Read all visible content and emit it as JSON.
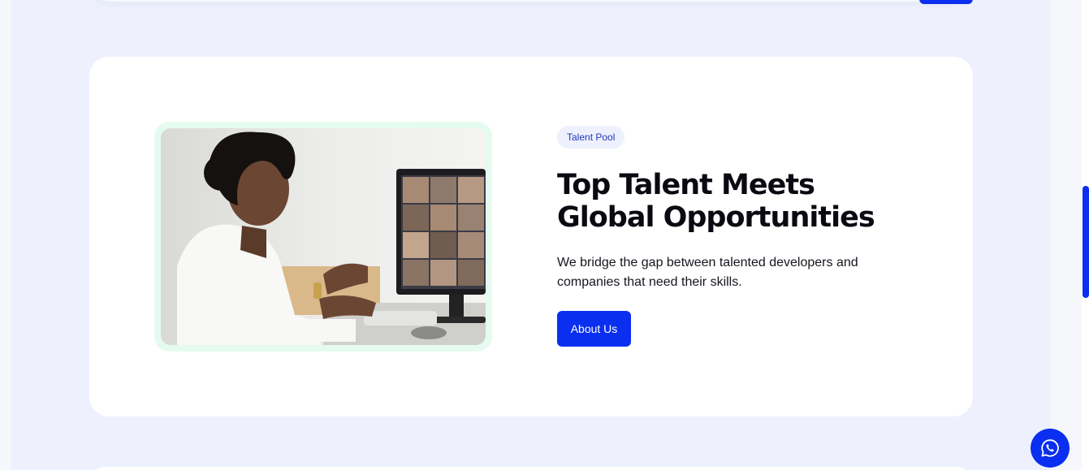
{
  "section": {
    "badge": "Talent Pool",
    "headline_line1": "Top Talent Meets",
    "headline_line2": "Global Opportunities",
    "description": "We bridge the gap between talented developers and companies that need their skills.",
    "cta_label": "About Us"
  },
  "image": {
    "description_icon": "video-call-photo"
  },
  "floating": {
    "chat_icon": "whatsapp-icon"
  },
  "colors": {
    "accent": "#0a2ff0",
    "page_bg": "#eef1fd",
    "image_frame": "#e6fbf0",
    "heading": "#0a0a12"
  }
}
